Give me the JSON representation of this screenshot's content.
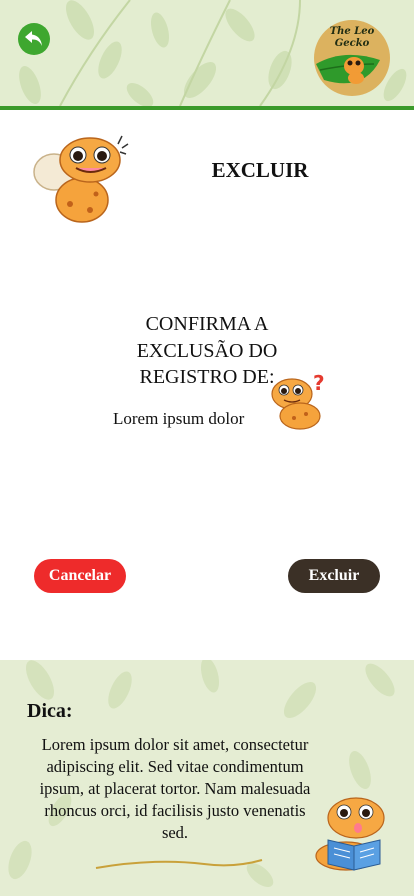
{
  "header": {
    "back_icon": "back-arrow-icon",
    "logo_text_line1": "The Leo",
    "logo_text_line2": "Gecko",
    "accent_color": "#3b9a2a"
  },
  "main": {
    "title": "EXCLUIR",
    "confirm_line1": "CONFIRMA A",
    "confirm_line2": "EXCLUSÃO DO",
    "confirm_line3": "REGISTRO DE:",
    "record_name": "Lorem ipsum dolor"
  },
  "actions": {
    "cancel_label": "Cancelar",
    "cancel_color": "#ee2b2b",
    "delete_label": "Excluir",
    "delete_color": "#3b3026"
  },
  "tip": {
    "label": "Dica:",
    "text": "Lorem ipsum dolor sit amet, consectetur adipiscing elit. Sed vitae condimentum ipsum, at placerat tortor. Nam malesuada rhoncus orci, id facilisis justo venenatis sed."
  }
}
